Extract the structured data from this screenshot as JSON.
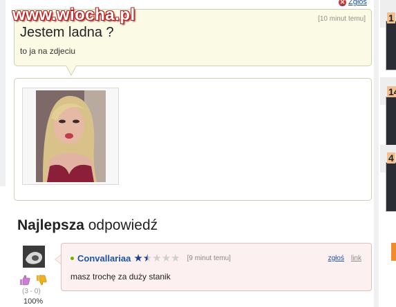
{
  "watermark": "www.wiocha.pl",
  "report_top": {
    "label": "Zgłoś"
  },
  "question": {
    "time": "[10 minut temu]",
    "title": "Jestem ladna ?",
    "body": "to ja na zdjeciu"
  },
  "best_answer": {
    "heading_bold": "Najlepsza",
    "heading_rest": " odpowiedź",
    "votes": "(3 - 0)",
    "percent": "100%",
    "user": "Convallariaa",
    "rating": {
      "value": 1.5,
      "max": 5
    },
    "time": "[9 minut temu]",
    "report_label": "zgłoś",
    "link_label": "link",
    "text": "masz trochę za duży stanik"
  },
  "sidebar": {
    "ranks": [
      "1",
      "14",
      "4"
    ]
  },
  "colors": {
    "link": "#1b53a8",
    "question_bg": "#fbfae5",
    "answer_bg": "#fdf0f0",
    "star": "#1e3e8e",
    "online": "#6fb000",
    "report_icon": "#d8322c"
  }
}
